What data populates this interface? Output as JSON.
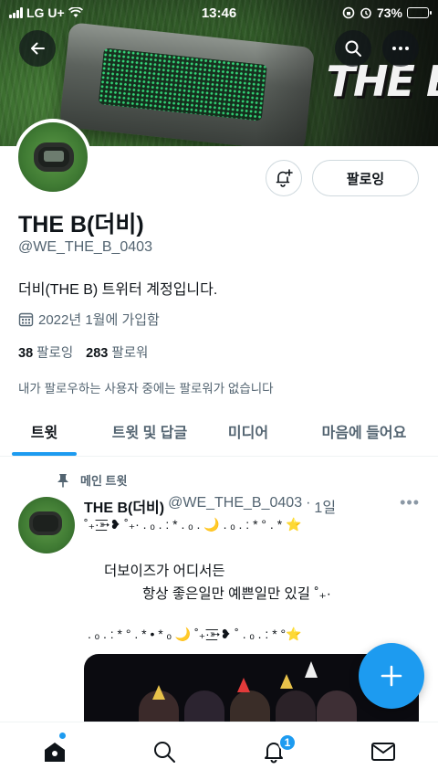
{
  "status_bar": {
    "carrier": "LG U+",
    "time": "13:46",
    "battery": "73%",
    "battery_level": 0.73
  },
  "profile": {
    "name": "THE B(더비)",
    "handle": "@WE_THE_B_0403",
    "bio": "더비(THE B) 트위터 계정입니다.",
    "joined": "2022년 1월에 가입함",
    "following_count": "38",
    "following_label": "팔로잉",
    "followers_count": "283",
    "followers_label": "팔로워",
    "no_mutuals": "내가 팔로우하는 사용자 중에는 팔로워가 없습니다",
    "follow_button": "팔로잉"
  },
  "banner": {
    "brand_text": "THE B"
  },
  "tabs": [
    {
      "label": "트윗",
      "active": true
    },
    {
      "label": "트윗 및 답글",
      "active": false
    },
    {
      "label": "미디어",
      "active": false
    },
    {
      "label": "마음에 들어요",
      "active": false
    }
  ],
  "tweet": {
    "pinned_label": "메인 트윗",
    "name": "THE B(더비)",
    "handle": "@WE_THE_B_0403",
    "separator": "·",
    "time": "1일",
    "line1": "˚₊·͟͟͞͞➳❥ ˚₊· . ₒ . : * . ₒ . 🌙 . ₒ . : * ° . * ⭐",
    "line2": "더보이즈가 어디서든",
    "line3": "항상 좋은일만 예쁜일만 있길 ˚₊·",
    "line4": ". ₒ . : * ° . * • * ₒ 🌙 ˚₊·͟͟͞͞➳❥ ˚ . ₒ . : * °⭐"
  },
  "nav": {
    "notification_count": "1"
  },
  "colors": {
    "accent": "#1d9bf0",
    "text": "#0f1419",
    "secondary": "#536471"
  }
}
